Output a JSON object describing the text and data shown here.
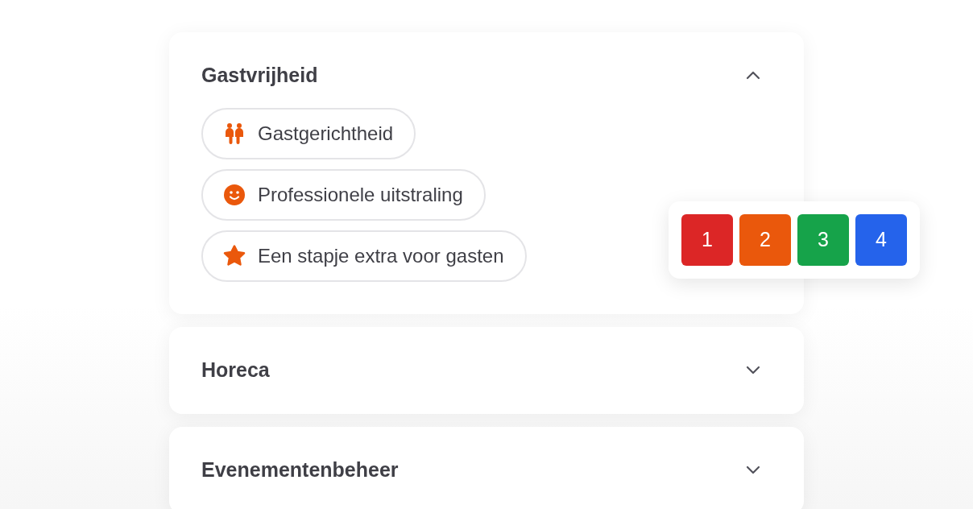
{
  "sections": [
    {
      "title": "Gastvrijheid",
      "expanded": true,
      "items": [
        {
          "kind": "people",
          "label": "Gastgerichtheid"
        },
        {
          "kind": "smile",
          "label": "Professionele uitstraling"
        },
        {
          "kind": "star",
          "label": "Een stapje extra voor gasten"
        }
      ]
    },
    {
      "title": "Horeca",
      "expanded": false
    },
    {
      "title": "Evenementenbeheer",
      "expanded": false
    }
  ],
  "rating_popup": {
    "options": [
      {
        "label": "1",
        "color": "#dc2626"
      },
      {
        "label": "2",
        "color": "#ea580c"
      },
      {
        "label": "3",
        "color": "#16a34a"
      },
      {
        "label": "4",
        "color": "#2563eb"
      }
    ]
  }
}
